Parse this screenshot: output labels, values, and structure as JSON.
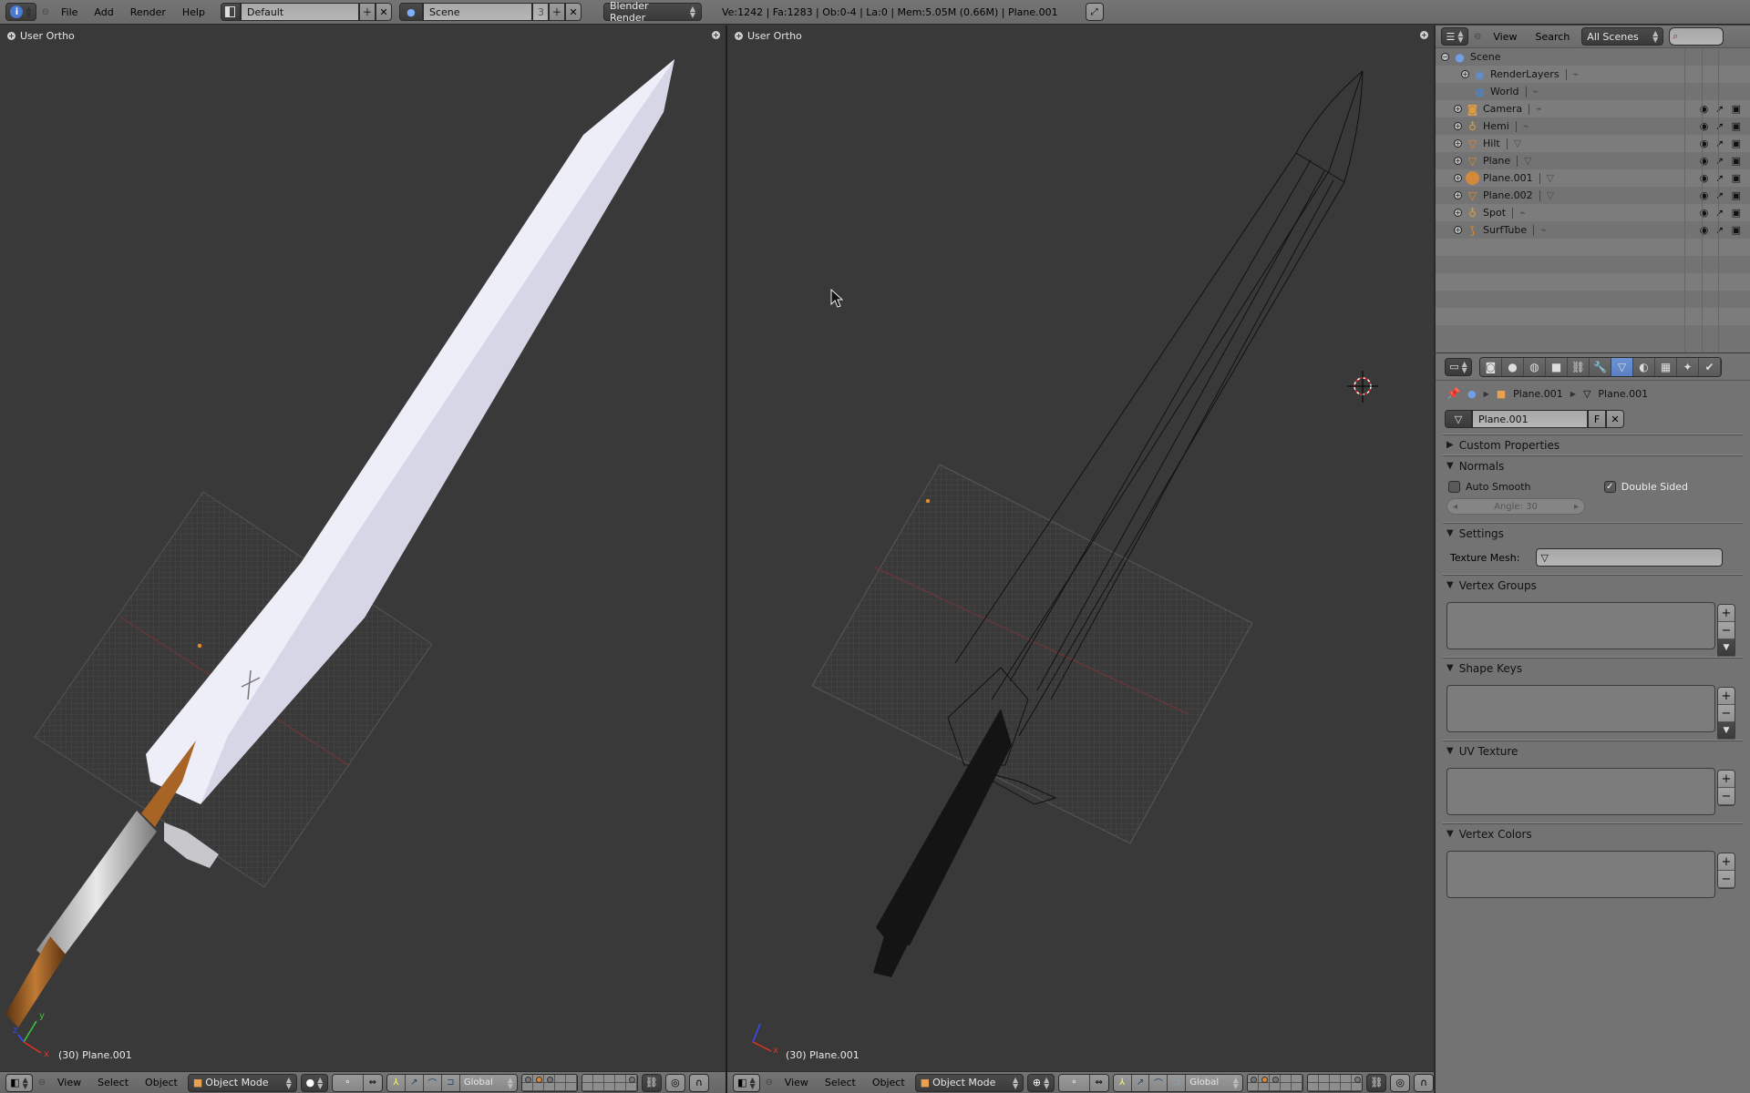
{
  "topbar": {
    "info_icon": "info-icon",
    "menus": [
      "File",
      "Add",
      "Render",
      "Help"
    ],
    "screen_layout": "Default",
    "scene": "Scene",
    "scene_users": "3",
    "render_engine": "Blender Render",
    "stats": "Ve:1242 | Fa:1283 | Ob:0-4 | La:0 | Mem:5.05M (0.66M) | Plane.001"
  },
  "viewports": [
    {
      "title": "User Ortho",
      "shading": "solid",
      "object_label": "(30) Plane.001",
      "menus": [
        "View",
        "Select",
        "Object"
      ],
      "mode": "Object Mode",
      "orientation": "Global"
    },
    {
      "title": "User Ortho",
      "shading": "wireframe",
      "object_label": "(30) Plane.001",
      "menus": [
        "View",
        "Select",
        "Object"
      ],
      "mode": "Object Mode",
      "orientation": "Global"
    }
  ],
  "axes": {
    "x": "x",
    "y": "y",
    "z": "z"
  },
  "outliner": {
    "menus": [
      "View",
      "Search"
    ],
    "display_mode": "All Scenes",
    "search_placeholder": "",
    "root": "Scene",
    "items": [
      {
        "name": "RenderLayers",
        "type": "renderlayers",
        "indent": 1,
        "restrict": false
      },
      {
        "name": "World",
        "type": "world",
        "indent": 1,
        "restrict": false
      },
      {
        "name": "Camera",
        "type": "camera",
        "indent": 1,
        "restrict": true
      },
      {
        "name": "Hemi",
        "type": "lamp",
        "indent": 1,
        "restrict": true
      },
      {
        "name": "Hilt",
        "type": "mesh",
        "indent": 1,
        "restrict": true
      },
      {
        "name": "Plane",
        "type": "mesh",
        "indent": 1,
        "restrict": true
      },
      {
        "name": "Plane.001",
        "type": "mesh",
        "indent": 1,
        "restrict": true,
        "selected": true
      },
      {
        "name": "Plane.002",
        "type": "mesh",
        "indent": 1,
        "restrict": true
      },
      {
        "name": "Spot",
        "type": "lamp",
        "indent": 1,
        "restrict": true
      },
      {
        "name": "SurfTube",
        "type": "curve",
        "indent": 1,
        "restrict": true
      }
    ]
  },
  "properties": {
    "context_tabs": [
      "render",
      "scene",
      "world",
      "object",
      "constraints",
      "modifiers",
      "data",
      "material",
      "texture",
      "particles",
      "physics"
    ],
    "active_tab": "data",
    "breadcrumb": [
      "Plane.001",
      "Plane.001"
    ],
    "datablock_name": "Plane.001",
    "fake_user": "F",
    "panels": {
      "custom_properties": "Custom Properties",
      "normals": "Normals",
      "auto_smooth": {
        "label": "Auto Smooth",
        "checked": false
      },
      "double_sided": {
        "label": "Double Sided",
        "checked": true
      },
      "angle": "Angle: 30",
      "settings": "Settings",
      "texture_mesh_label": "Texture Mesh:",
      "texture_mesh_value": "",
      "vertex_groups": "Vertex Groups",
      "shape_keys": "Shape Keys",
      "uv_texture": "UV Texture",
      "vertex_colors": "Vertex Colors"
    }
  },
  "colors": {
    "viewport_bg": "#393939",
    "header_bg": "#727272",
    "active_tab": "#5f87c9",
    "selection_orange": "#e08a2a"
  }
}
